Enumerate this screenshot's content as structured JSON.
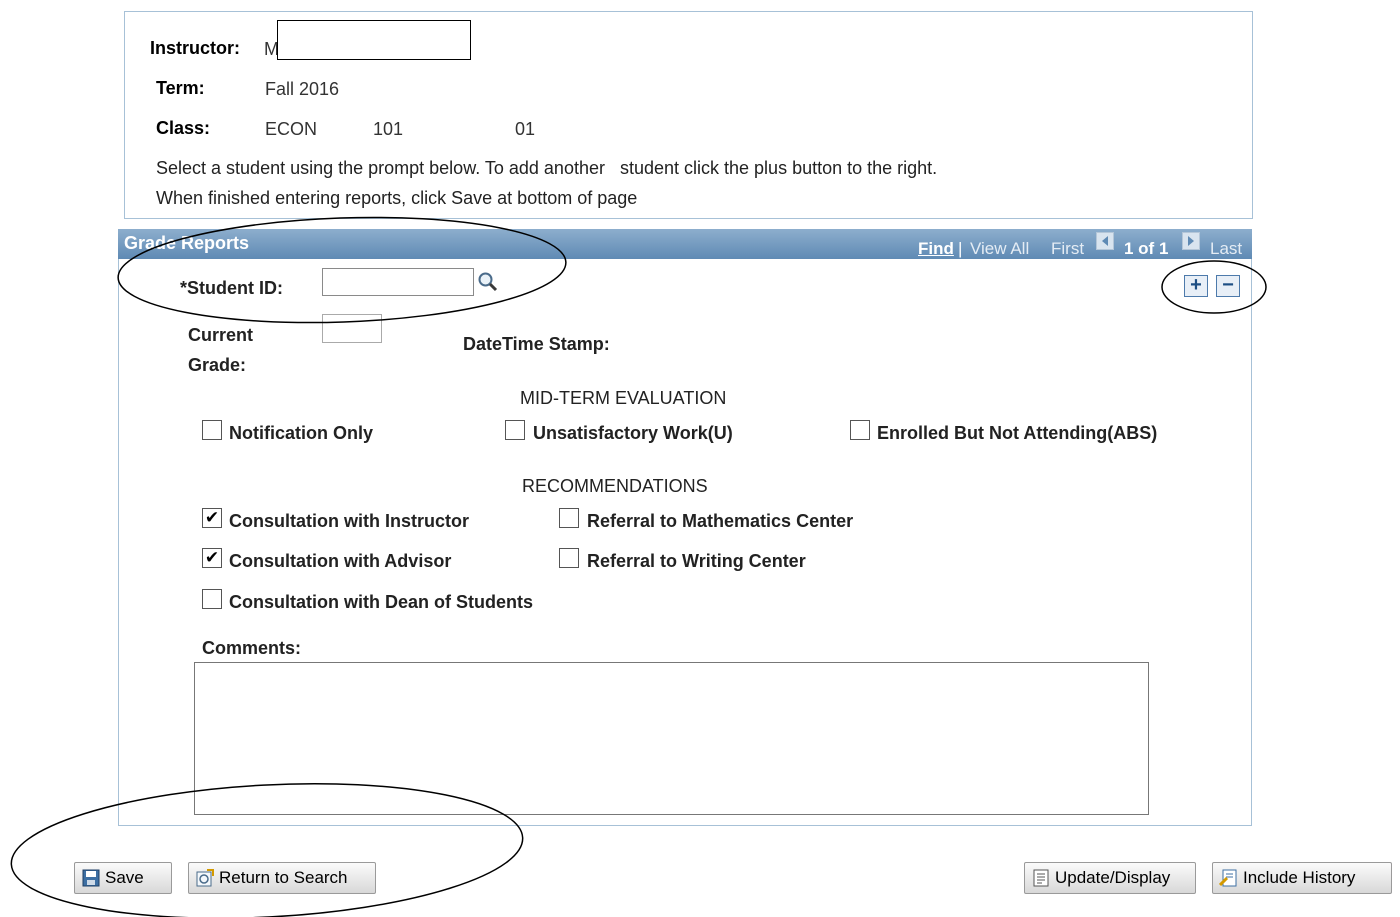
{
  "info": {
    "instructor_label": "Instructor:",
    "instructor_value": "M",
    "term_label": "Term:",
    "term_value": "Fall 2016",
    "class_label": "Class:",
    "class_subject": "ECON",
    "class_number": "101",
    "class_section": "01",
    "instruction_line1": "Select a student using the prompt below. To add another   student click the plus button to the right.",
    "instruction_line2": "When finished entering reports, click Save at bottom of page"
  },
  "grade_reports": {
    "title": "Grade Reports",
    "nav": {
      "find": "Find",
      "separator": "|",
      "view_all": "View All",
      "first": "First",
      "count": "1 of 1",
      "last": "Last"
    },
    "student_id_label": "*Student ID:",
    "student_id_value": "",
    "current_grade_label_1": "Current",
    "current_grade_label_2": "Grade:",
    "current_grade_value": "",
    "datetime_label": "DateTime Stamp:",
    "midterm_heading": "MID-TERM EVALUATION",
    "midterm_options": [
      {
        "label": "Notification Only",
        "checked": false
      },
      {
        "label": "Unsatisfactory Work(U)",
        "checked": false
      },
      {
        "label": "Enrolled But Not Attending(ABS)",
        "checked": false
      }
    ],
    "recommendations_heading": "RECOMMENDATIONS",
    "recommendations": [
      {
        "label": "Consultation with Instructor",
        "checked": true
      },
      {
        "label": "Referral to Mathematics Center",
        "checked": false
      },
      {
        "label": "Consultation with Advisor",
        "checked": true
      },
      {
        "label": "Referral to Writing Center",
        "checked": false
      },
      {
        "label": "Consultation with Dean of Students",
        "checked": false
      }
    ],
    "comments_label": "Comments:",
    "comments_value": ""
  },
  "buttons": {
    "save": "Save",
    "return_to_search": "Return to Search",
    "update_display": "Update/Display",
    "include_history": "Include History"
  }
}
